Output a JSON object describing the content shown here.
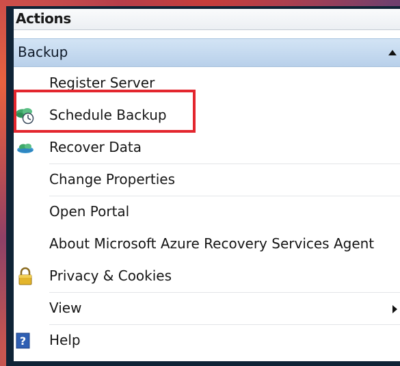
{
  "panel": {
    "title": "Actions"
  },
  "section": {
    "title": "Backup"
  },
  "items": [
    {
      "label": "Register Server",
      "icon": "none"
    },
    {
      "label": "Schedule Backup",
      "icon": "schedule-backup-icon"
    },
    {
      "label": "Recover Data",
      "icon": "cloud-recover-icon"
    },
    {
      "label": "Change Properties",
      "icon": "none"
    },
    {
      "label": "Open Portal",
      "icon": "none"
    },
    {
      "label": "About Microsoft Azure Recovery Services Agent",
      "icon": "none"
    },
    {
      "label": "Privacy & Cookies",
      "icon": "padlock-icon"
    },
    {
      "label": "View",
      "icon": "none",
      "submenu": true
    },
    {
      "label": "Help",
      "icon": "help-icon"
    }
  ],
  "colors": {
    "highlight_border": "#e3262e",
    "section_bg": "#c4d9ef",
    "frame": "#0f2336"
  }
}
